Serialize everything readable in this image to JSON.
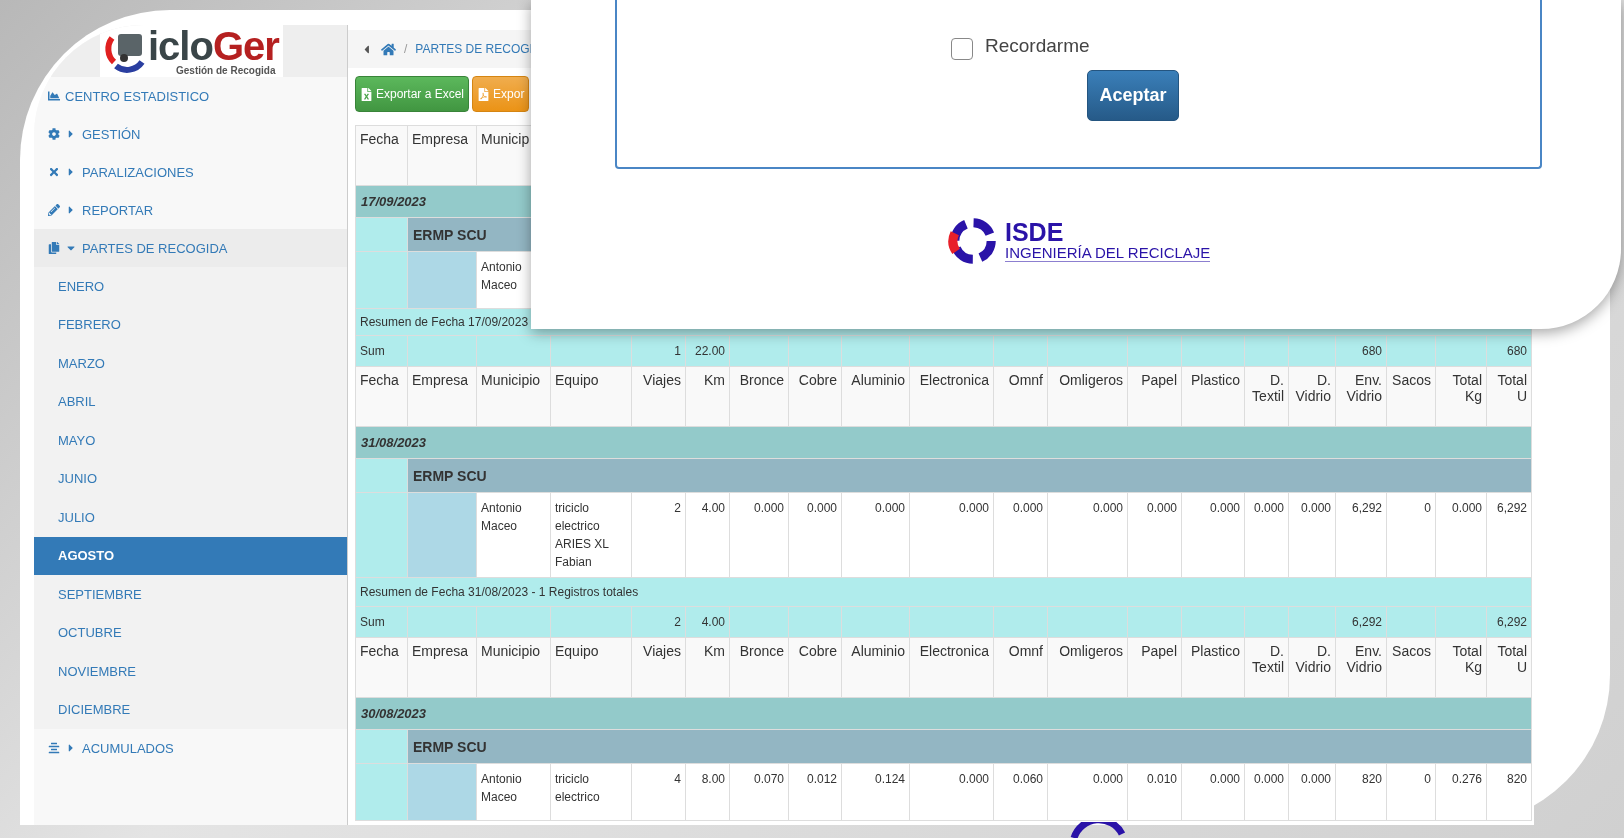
{
  "logo": {
    "text": "iclo",
    "accent": "Ger",
    "tagline": "Gestión de Recogida"
  },
  "sidebar": {
    "items": [
      {
        "label": "CENTRO ESTADISTICO",
        "kind": "link"
      },
      {
        "label": "GESTIÓN",
        "kind": "group",
        "expanded": false
      },
      {
        "label": "PARALIZACIONES",
        "kind": "group",
        "expanded": false
      },
      {
        "label": "REPORTAR",
        "kind": "group",
        "expanded": false
      },
      {
        "label": "PARTES DE RECOGIDA",
        "kind": "group",
        "expanded": true,
        "children": [
          {
            "label": "ENERO",
            "selected": false
          },
          {
            "label": "FEBRERO",
            "selected": false
          },
          {
            "label": "MARZO",
            "selected": false
          },
          {
            "label": "ABRIL",
            "selected": false
          },
          {
            "label": "MAYO",
            "selected": false
          },
          {
            "label": "JUNIO",
            "selected": false
          },
          {
            "label": "JULIO",
            "selected": false
          },
          {
            "label": "AGOSTO",
            "selected": true
          },
          {
            "label": "SEPTIEMBRE",
            "selected": false
          },
          {
            "label": "OCTUBRE",
            "selected": false
          },
          {
            "label": "NOVIEMBRE",
            "selected": false
          },
          {
            "label": "DICIEMBRE",
            "selected": false
          }
        ]
      },
      {
        "label": "ACUMULADOS",
        "kind": "group",
        "expanded": false
      }
    ]
  },
  "breadcrumb": {
    "separator": "/",
    "current": "PARTES DE RECOGI"
  },
  "buttons": [
    {
      "label": "Exportar a Excel",
      "kind": "excel"
    },
    {
      "label": "Expor",
      "kind": "pdf"
    }
  ],
  "table": {
    "sections": [
      {
        "columns": [
          "Fecha",
          "Empresa",
          "Municip"
        ],
        "date": "17/09/2023",
        "group": "ERMP SCU",
        "rows": [
          {
            "municipio": "Antonio Maceo"
          }
        ],
        "summary": "Resumen de Fecha 17/09/2023",
        "sum": {
          "label": "Sum",
          "viajes": "1",
          "km": "22.00",
          "env_vidrio": "680",
          "total_u": "680"
        }
      },
      {
        "columns": [
          "Fecha",
          "Empresa",
          "Municipio",
          "Equipo",
          "Viajes",
          "Km",
          "Bronce",
          "Cobre",
          "Aluminio",
          "Electronica",
          "Omnf",
          "Omligeros",
          "Papel",
          "Plastico",
          "D. Textil",
          "D. Vidrio",
          "Env. Vidrio",
          "Sacos",
          "Total Kg",
          "Total U"
        ],
        "date": "31/08/2023",
        "group": "ERMP SCU",
        "rows": [
          {
            "municipio": "Antonio Maceo",
            "equipo": "triciclo electrico ARIES XL Fabian",
            "values": [
              "2",
              "4.00",
              "0.000",
              "0.000",
              "0.000",
              "0.000",
              "0.000",
              "0.000",
              "0.000",
              "0.000",
              "0.000",
              "0.000",
              "6,292",
              "0",
              "0.000",
              "6,292"
            ]
          }
        ],
        "summary": "Resumen de Fecha 31/08/2023 - 1 Registros totales",
        "sum": {
          "label": "Sum",
          "viajes": "2",
          "km": "4.00",
          "env_vidrio": "6,292",
          "total_u": "6,292"
        }
      },
      {
        "columns": [
          "Fecha",
          "Empresa",
          "Municipio",
          "Equipo",
          "Viajes",
          "Km",
          "Bronce",
          "Cobre",
          "Aluminio",
          "Electronica",
          "Omnf",
          "Omligeros",
          "Papel",
          "Plastico",
          "D. Textil",
          "D. Vidrio",
          "Env. Vidrio",
          "Sacos",
          "Total Kg",
          "Total U"
        ],
        "date": "30/08/2023",
        "group": "ERMP SCU",
        "rows": [
          {
            "municipio": "Antonio Maceo",
            "equipo": "triciclo electrico",
            "values": [
              "4",
              "8.00",
              "0.070",
              "0.012",
              "0.124",
              "0.000",
              "0.060",
              "0.000",
              "0.010",
              "0.000",
              "0.000",
              "0.000",
              "820",
              "0",
              "0.276",
              "820"
            ]
          }
        ]
      }
    ]
  },
  "dialog": {
    "remember": {
      "label": "Recordarme",
      "checked": false
    },
    "submit": "Aceptar",
    "footer_logo": {
      "name": "ISDE",
      "subtitle": "INGENIERÍA DEL RECICLAJE"
    }
  }
}
